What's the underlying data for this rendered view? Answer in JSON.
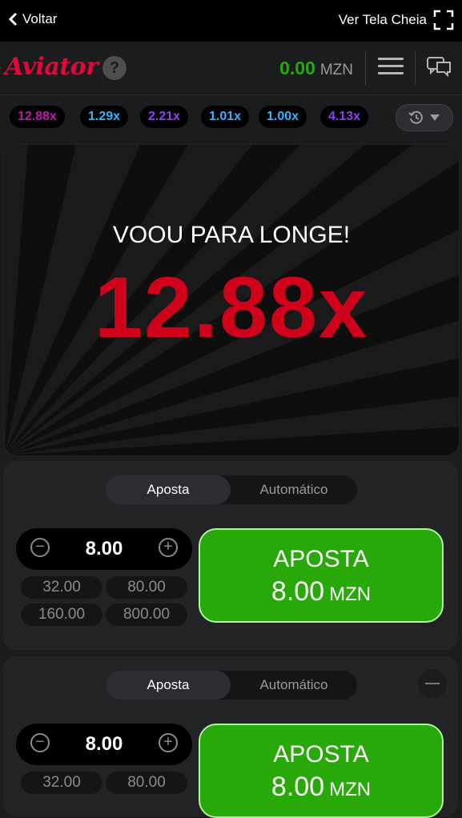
{
  "topbar": {
    "back_label": "Voltar",
    "fullscreen_label": "Ver Tela Cheia"
  },
  "header": {
    "logo_text": "Aviator",
    "help_symbol": "?",
    "balance": "0.00",
    "currency": "MZN"
  },
  "history": {
    "multipliers": [
      {
        "value": "12.88x",
        "color": "#c017b4"
      },
      {
        "value": "1.29x",
        "color": "#34b4ff"
      },
      {
        "value": "2.21x",
        "color": "#913ef8"
      },
      {
        "value": "1.01x",
        "color": "#34b4ff"
      },
      {
        "value": "1.00x",
        "color": "#34b4ff"
      },
      {
        "value": "4.13x",
        "color": "#913ef8"
      }
    ]
  },
  "game": {
    "flew_away_text": "VOOU PARA LONGE!",
    "multiplier": "12.88x"
  },
  "bet_panels": [
    {
      "tab_bet": "Aposta",
      "tab_auto": "Automático",
      "amount": "8.00",
      "minus_symbol": "−",
      "plus_symbol": "+",
      "quick_amounts": [
        "32.00",
        "80.00",
        "160.00",
        "800.00"
      ],
      "button_line1": "APOSTA",
      "button_amount": "8.00",
      "button_currency": "MZN"
    },
    {
      "tab_bet": "Aposta",
      "tab_auto": "Automático",
      "amount": "8.00",
      "minus_symbol": "−",
      "plus_symbol": "+",
      "quick_amounts": [
        "32.00",
        "80.00"
      ],
      "button_line1": "APOSTA",
      "button_amount": "8.00",
      "button_currency": "MZN"
    }
  ],
  "colors": {
    "accent_red": "#e50539",
    "multiplier_red": "#d0021b",
    "bet_green": "#28a909"
  }
}
